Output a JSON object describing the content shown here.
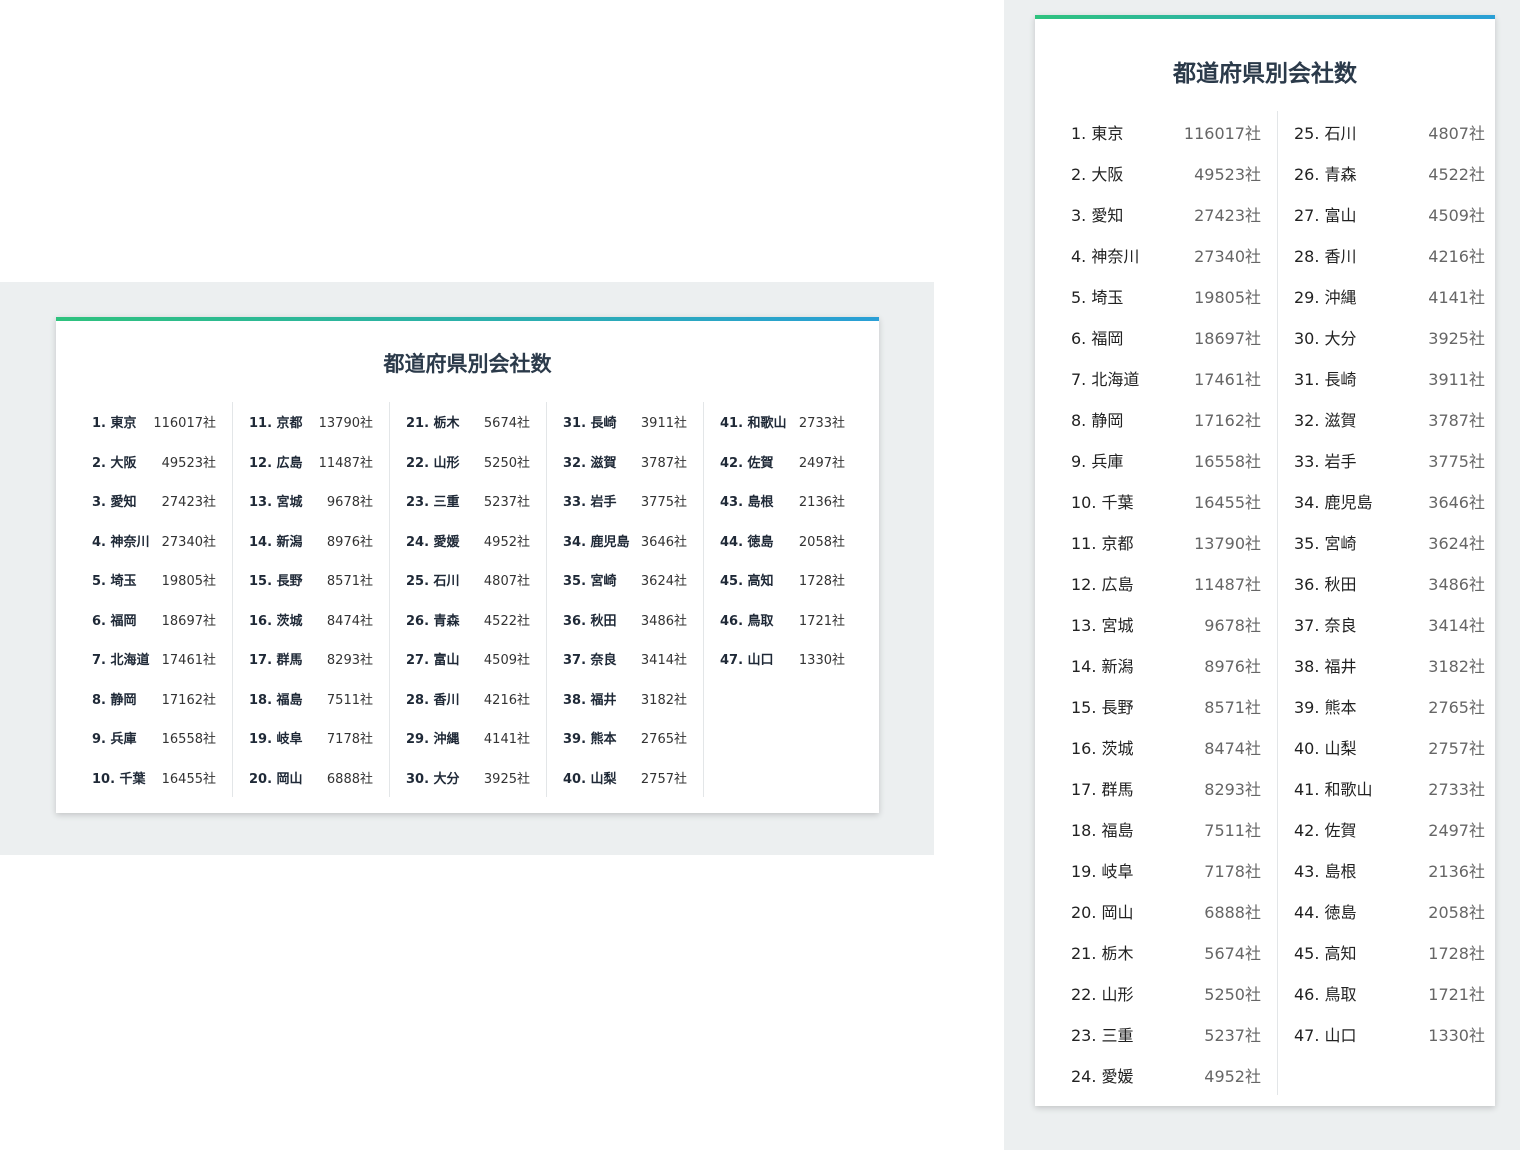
{
  "title": "都道府県別会社数",
  "unit": "社",
  "prefectures": [
    {
      "rank": 1,
      "name": "東京",
      "count": 116017
    },
    {
      "rank": 2,
      "name": "大阪",
      "count": 49523
    },
    {
      "rank": 3,
      "name": "愛知",
      "count": 27423
    },
    {
      "rank": 4,
      "name": "神奈川",
      "count": 27340
    },
    {
      "rank": 5,
      "name": "埼玉",
      "count": 19805
    },
    {
      "rank": 6,
      "name": "福岡",
      "count": 18697
    },
    {
      "rank": 7,
      "name": "北海道",
      "count": 17461
    },
    {
      "rank": 8,
      "name": "静岡",
      "count": 17162
    },
    {
      "rank": 9,
      "name": "兵庫",
      "count": 16558
    },
    {
      "rank": 10,
      "name": "千葉",
      "count": 16455
    },
    {
      "rank": 11,
      "name": "京都",
      "count": 13790
    },
    {
      "rank": 12,
      "name": "広島",
      "count": 11487
    },
    {
      "rank": 13,
      "name": "宮城",
      "count": 9678
    },
    {
      "rank": 14,
      "name": "新潟",
      "count": 8976
    },
    {
      "rank": 15,
      "name": "長野",
      "count": 8571
    },
    {
      "rank": 16,
      "name": "茨城",
      "count": 8474
    },
    {
      "rank": 17,
      "name": "群馬",
      "count": 8293
    },
    {
      "rank": 18,
      "name": "福島",
      "count": 7511
    },
    {
      "rank": 19,
      "name": "岐阜",
      "count": 7178
    },
    {
      "rank": 20,
      "name": "岡山",
      "count": 6888
    },
    {
      "rank": 21,
      "name": "栃木",
      "count": 5674
    },
    {
      "rank": 22,
      "name": "山形",
      "count": 5250
    },
    {
      "rank": 23,
      "name": "三重",
      "count": 5237
    },
    {
      "rank": 24,
      "name": "愛媛",
      "count": 4952
    },
    {
      "rank": 25,
      "name": "石川",
      "count": 4807
    },
    {
      "rank": 26,
      "name": "青森",
      "count": 4522
    },
    {
      "rank": 27,
      "name": "富山",
      "count": 4509
    },
    {
      "rank": 28,
      "name": "香川",
      "count": 4216
    },
    {
      "rank": 29,
      "name": "沖縄",
      "count": 4141
    },
    {
      "rank": 30,
      "name": "大分",
      "count": 3925
    },
    {
      "rank": 31,
      "name": "長崎",
      "count": 3911
    },
    {
      "rank": 32,
      "name": "滋賀",
      "count": 3787
    },
    {
      "rank": 33,
      "name": "岩手",
      "count": 3775
    },
    {
      "rank": 34,
      "name": "鹿児島",
      "count": 3646
    },
    {
      "rank": 35,
      "name": "宮崎",
      "count": 3624
    },
    {
      "rank": 36,
      "name": "秋田",
      "count": 3486
    },
    {
      "rank": 37,
      "name": "奈良",
      "count": 3414
    },
    {
      "rank": 38,
      "name": "福井",
      "count": 3182
    },
    {
      "rank": 39,
      "name": "熊本",
      "count": 2765
    },
    {
      "rank": 40,
      "name": "山梨",
      "count": 2757
    },
    {
      "rank": 41,
      "name": "和歌山",
      "count": 2733
    },
    {
      "rank": 42,
      "name": "佐賀",
      "count": 2497
    },
    {
      "rank": 43,
      "name": "島根",
      "count": 2136
    },
    {
      "rank": 44,
      "name": "徳島",
      "count": 2058
    },
    {
      "rank": 45,
      "name": "高知",
      "count": 1728
    },
    {
      "rank": 46,
      "name": "鳥取",
      "count": 1721
    },
    {
      "rank": 47,
      "name": "山口",
      "count": 1330
    }
  ]
}
